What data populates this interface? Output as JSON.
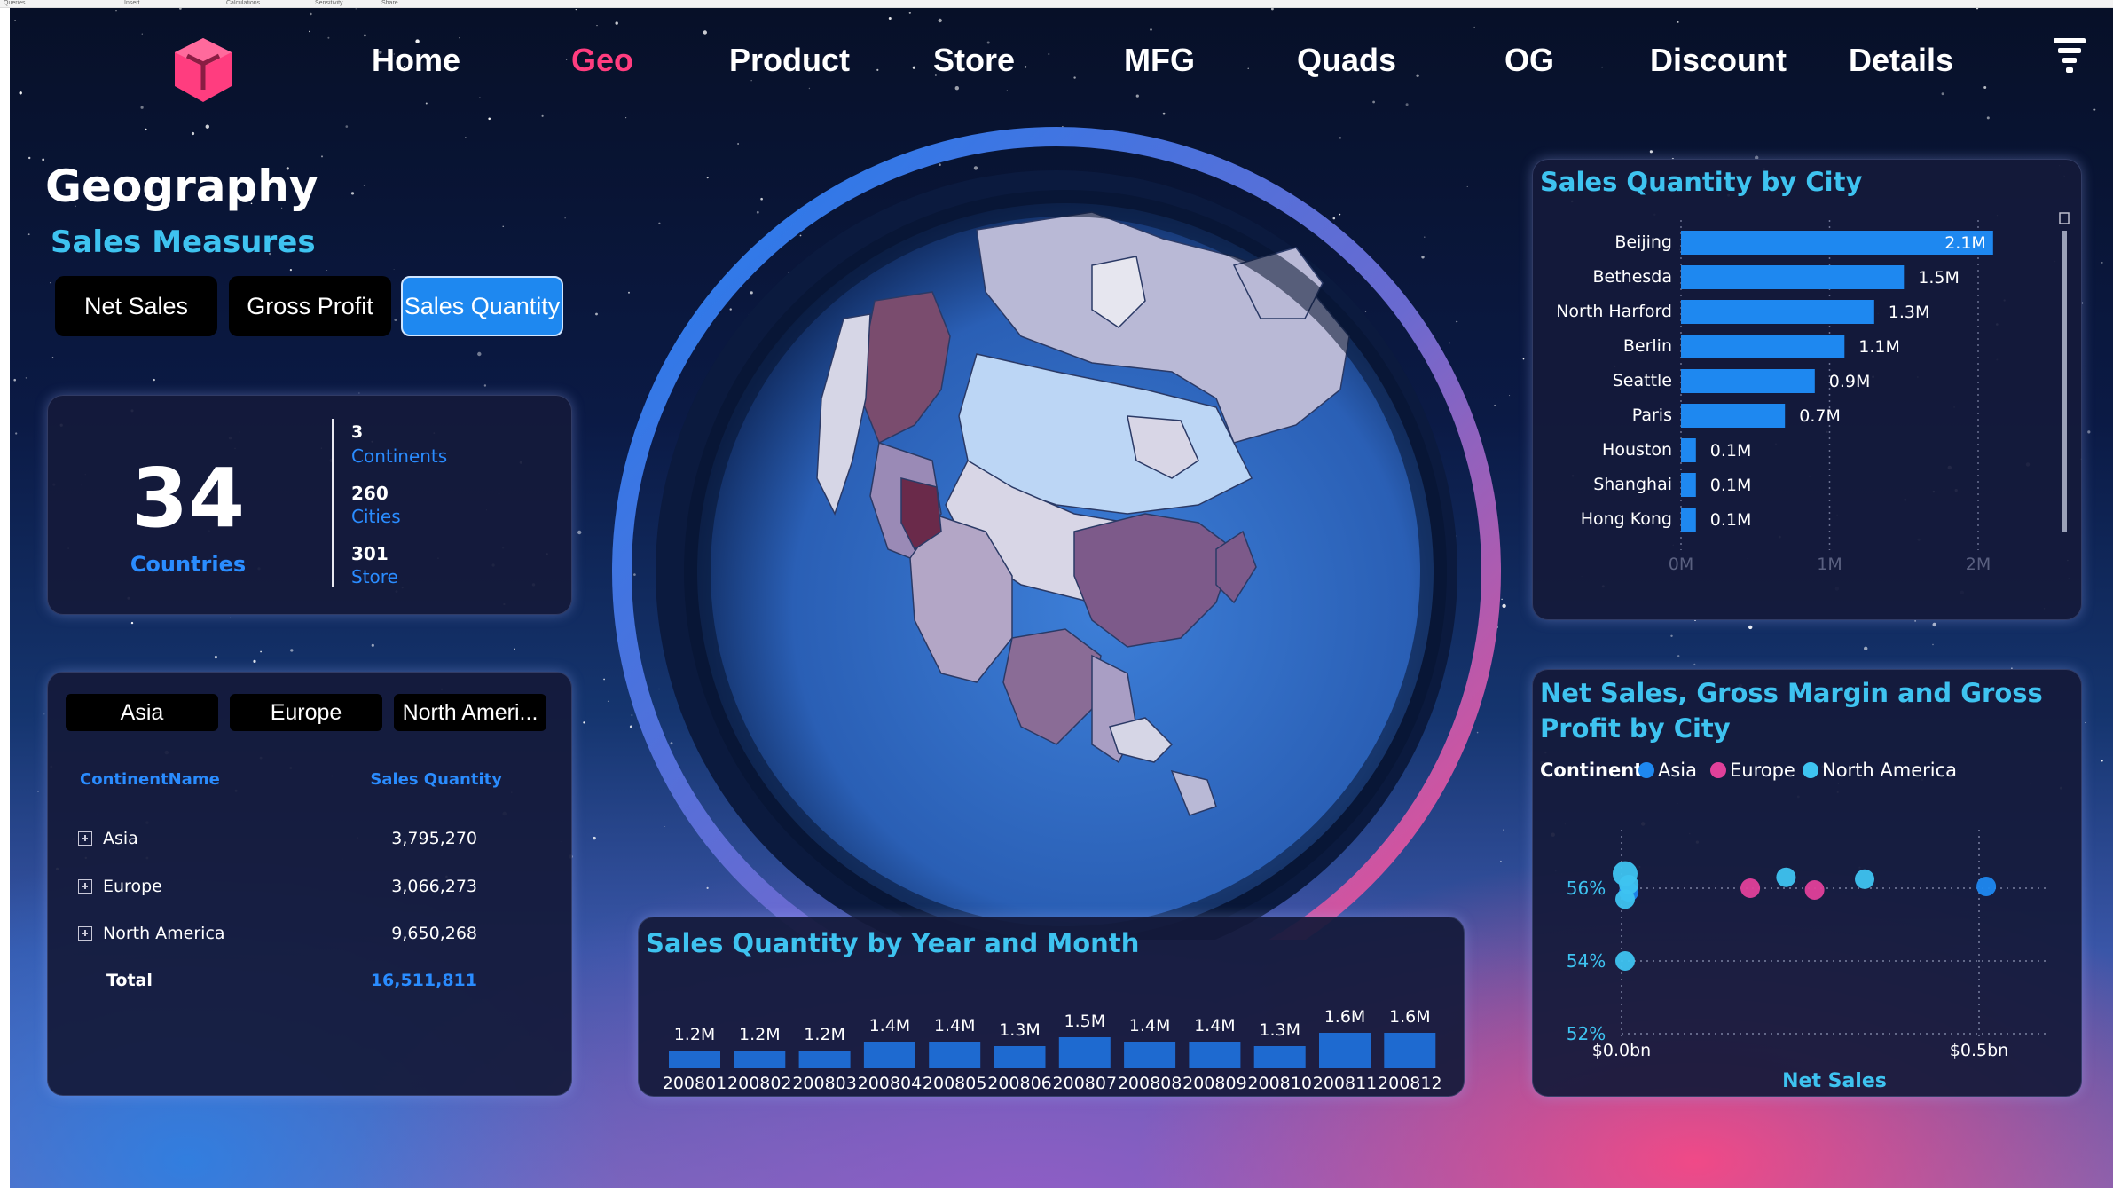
{
  "topbar": {
    "items": [
      "Queries",
      "Insert",
      "Calculations",
      "Sensitivity",
      "Share"
    ]
  },
  "nav": {
    "items": [
      "Home",
      "Geo",
      "Product",
      "Store",
      "MFG",
      "Quads",
      "OG",
      "Discount",
      "Details"
    ],
    "active": "Geo"
  },
  "page": {
    "title": "Geography",
    "subtitle": "Sales Measures"
  },
  "measure_buttons": {
    "net_sales": "Net Sales",
    "gross_profit": "Gross Profit",
    "sales_quantity": "Sales Quantity",
    "selected": "Sales Quantity"
  },
  "kpi": {
    "countries_value": "34",
    "countries_label": "Countries",
    "continents_value": "3",
    "continents_label": "Continents",
    "cities_value": "260",
    "cities_label": "Cities",
    "stores_value": "301",
    "stores_label": "Store"
  },
  "continent_table": {
    "buttons": [
      "Asia",
      "Europe",
      "North Ameri..."
    ],
    "headers": [
      "ContinentName",
      "Sales Quantity"
    ],
    "rows": [
      {
        "name": "Asia",
        "value": "3,795,270"
      },
      {
        "name": "Europe",
        "value": "3,066,273"
      },
      {
        "name": "North America",
        "value": "9,650,268"
      }
    ],
    "total_label": "Total",
    "total_value": "16,511,811"
  },
  "colors": {
    "accent_pink": "#ff3d7f",
    "accent_cyan": "#3ec3f0",
    "bar_blue": "#1e88f0",
    "asia": "#1e88f0",
    "europe": "#e0409a",
    "north_america": "#3ec3f0"
  },
  "icons": {
    "logo": "cube-logo-icon",
    "filter": "filter-icon",
    "expand": "plus-box-icon"
  },
  "chart_data": [
    {
      "type": "bar",
      "orientation": "horizontal",
      "title": "Sales Quantity by City",
      "categories": [
        "Beijing",
        "Bethesda",
        "North Harford",
        "Berlin",
        "Seattle",
        "Paris",
        "Houston",
        "Shanghai",
        "Hong Kong"
      ],
      "values": [
        2.1,
        1.5,
        1.3,
        1.1,
        0.9,
        0.7,
        0.1,
        0.1,
        0.1
      ],
      "labels": [
        "2.1M",
        "1.5M",
        "1.3M",
        "1.1M",
        "0.9M",
        "0.7M",
        "0.1M",
        "0.1M",
        "0.1M"
      ],
      "xticks": [
        "0M",
        "1M",
        "2M"
      ],
      "xlim": [
        0,
        2
      ],
      "grid": true
    },
    {
      "type": "bar",
      "title": "Sales Quantity by Year and Month",
      "categories": [
        "200801",
        "200802",
        "200803",
        "200804",
        "200805",
        "200806",
        "200807",
        "200808",
        "200809",
        "200810",
        "200811",
        "200812"
      ],
      "values": [
        1.2,
        1.2,
        1.2,
        1.4,
        1.4,
        1.3,
        1.5,
        1.4,
        1.4,
        1.3,
        1.6,
        1.6
      ],
      "labels": [
        "1.2M",
        "1.2M",
        "1.2M",
        "1.4M",
        "1.4M",
        "1.3M",
        "1.5M",
        "1.4M",
        "1.4M",
        "1.3M",
        "1.6M",
        "1.6M"
      ]
    },
    {
      "type": "scatter",
      "title": "Net Sales, Gross Margin and Gross Profit by City",
      "legend_title": "Continent",
      "legend": [
        "Asia",
        "Europe",
        "North America"
      ],
      "xlabel": "Net Sales",
      "xticks": [
        "$0.0bn",
        "$0.5bn"
      ],
      "yticks": [
        "56%",
        "54%",
        "52%"
      ],
      "xlim": [
        0,
        0.6
      ],
      "ylim": [
        52,
        57.5
      ],
      "series": [
        {
          "name": "Asia",
          "points": [
            [
              0.01,
              55.9
            ],
            [
              0.51,
              56.05
            ]
          ]
        },
        {
          "name": "Europe",
          "points": [
            [
              0.18,
              56.0
            ],
            [
              0.27,
              55.95
            ]
          ]
        },
        {
          "name": "North America",
          "points": [
            [
              0.005,
              56.4
            ],
            [
              0.01,
              56.1
            ],
            [
              0.005,
              55.7
            ],
            [
              0.23,
              56.3
            ],
            [
              0.34,
              56.25
            ],
            [
              0.005,
              54.0
            ]
          ]
        }
      ]
    }
  ]
}
